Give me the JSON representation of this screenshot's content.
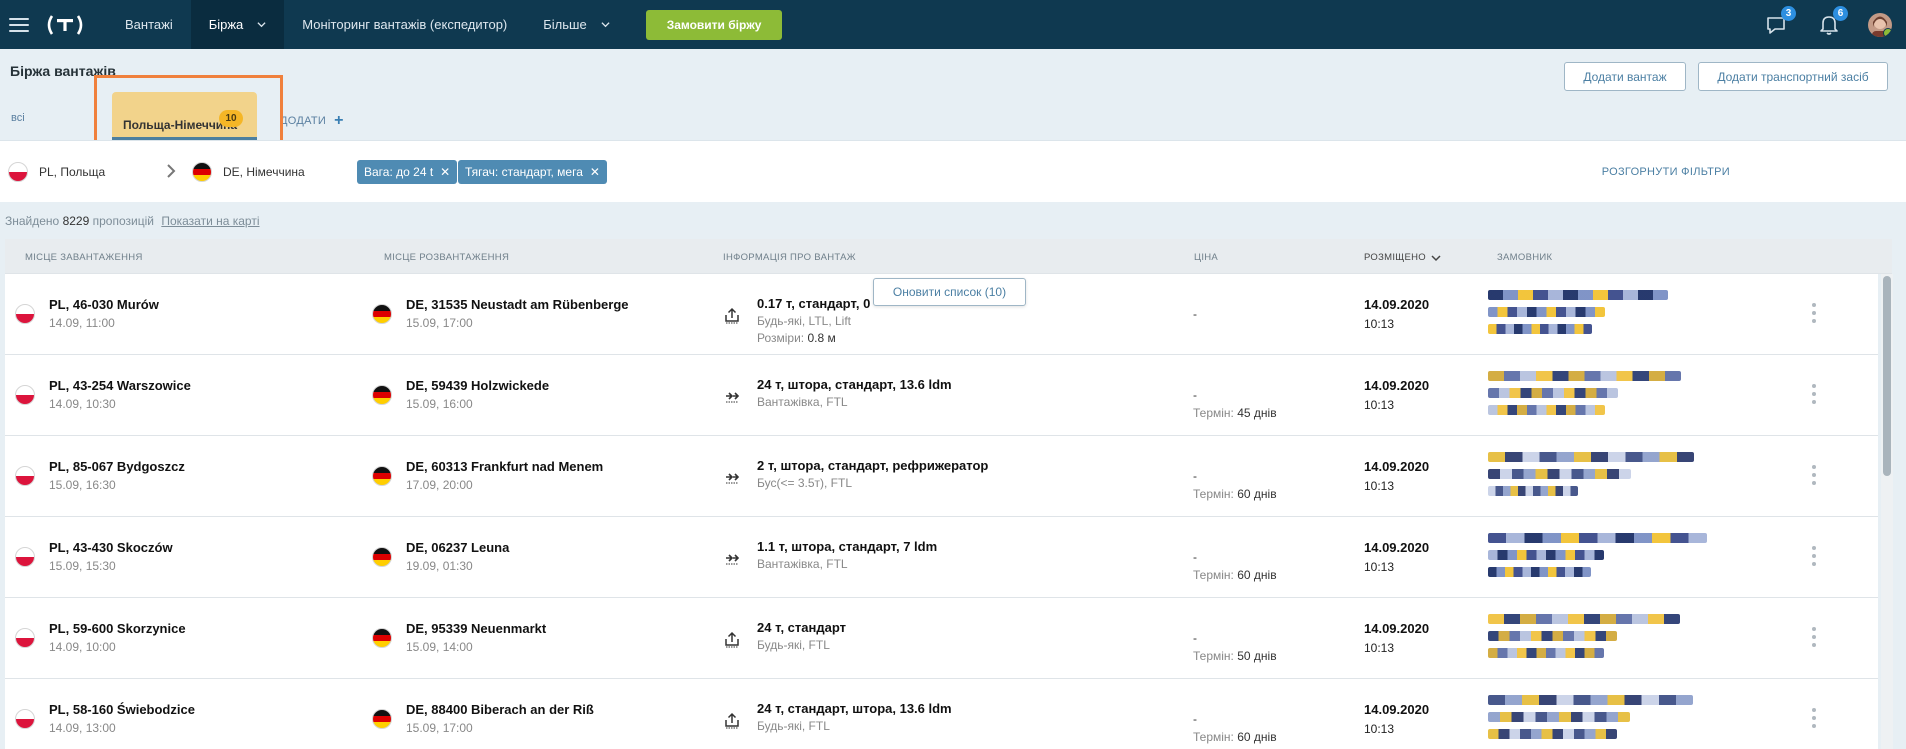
{
  "nav": {
    "logo_text": "(T)",
    "items": [
      {
        "label": "Вантажі",
        "active": false,
        "dropdown": false
      },
      {
        "label": "Біржа",
        "active": true,
        "dropdown": true
      },
      {
        "label": "Моніторинг вантажів (експедитор)",
        "active": false,
        "dropdown": false
      },
      {
        "label": "Більше",
        "active": false,
        "dropdown": true
      }
    ],
    "order_button": "Замовити біржу",
    "messages_badge": "3",
    "notifications_badge": "6"
  },
  "page": {
    "title": "Біржа вантажів",
    "add_cargo": "Додати вантаж",
    "add_vehicle": "Додати транспортний засіб"
  },
  "tabs": {
    "all": "всі",
    "active_label": "Польща-Німеччина",
    "active_count": "10",
    "add": "ДОДАТИ"
  },
  "filters": {
    "from": "PL, Польща",
    "to": "DE, Німеччина",
    "chips": [
      "Вага: до 24 t",
      "Тягач: стандарт, мега"
    ],
    "expand": "РОЗГОРНУТИ ФІЛЬТРИ"
  },
  "found": {
    "prefix": "Знайдено",
    "count": "8229",
    "suffix": "пропозицій",
    "map_link": "Показати на карті"
  },
  "table": {
    "headers": {
      "load": "МІСЦЕ ЗАВАНТАЖЕННЯ",
      "unload": "МІСЦЕ РОЗВАНТАЖЕННЯ",
      "info": "ІНФОРМАЦІЯ ПРО ВАНТАЖ",
      "price": "ЦІНА",
      "posted": "РОЗМІЩЕНО",
      "customer": "ЗАМОВНИК"
    },
    "refresh_button": "Оновити список (10)",
    "term_label": "Термін:",
    "size_label": "Розміри:",
    "rows": [
      {
        "load_title": "PL, 46-030 Murów",
        "load_date": "14.09, 11:00",
        "unload_title": "DE, 31535 Neustadt am Rübenberge",
        "unload_date": "15.09, 17:00",
        "info_title": "0.17 т, стандарт, 0",
        "info_sub": "Будь-які, LTL, Lift",
        "info_size": "0.8 м",
        "price": "-",
        "term": "",
        "posted_date": "14.09.2020",
        "posted_time": "10:13",
        "icon": "loading-up-icon"
      },
      {
        "load_title": "PL, 43-254 Warszowice",
        "load_date": "14.09, 10:30",
        "unload_title": "DE, 59439 Holzwickede",
        "unload_date": "15.09, 16:00",
        "info_title": "24 т, штора, стандарт, 13.6 ldm",
        "info_sub": "Вантажівка, FTL",
        "info_size": "",
        "price": "-",
        "term": "45 днів",
        "posted_date": "14.09.2020",
        "posted_time": "10:13",
        "icon": "truck-arrow-icon"
      },
      {
        "load_title": "PL, 85-067 Bydgoszcz",
        "load_date": "15.09, 16:30",
        "unload_title": "DE, 60313 Frankfurt nad Menem",
        "unload_date": "17.09, 20:00",
        "info_title": "2 т, штора, стандарт, рефрижератор",
        "info_sub": "Бус(<= 3.5т), FTL",
        "info_size": "",
        "price": "-",
        "term": "60 днів",
        "posted_date": "14.09.2020",
        "posted_time": "10:13",
        "icon": "truck-arrow-icon"
      },
      {
        "load_title": "PL, 43-430 Skoczów",
        "load_date": "15.09, 15:30",
        "unload_title": "DE, 06237 Leuna",
        "unload_date": "19.09, 01:30",
        "info_title": "1.1 т, штора, стандарт, 7 ldm",
        "info_sub": "Вантажівка, FTL",
        "info_size": "",
        "price": "-",
        "term": "60 днів",
        "posted_date": "14.09.2020",
        "posted_time": "10:13",
        "icon": "truck-arrow-icon"
      },
      {
        "load_title": "PL, 59-600 Skorzynice",
        "load_date": "14.09, 10:00",
        "unload_title": "DE, 95339 Neuenmarkt",
        "unload_date": "15.09, 14:00",
        "info_title": "24 т, стандарт",
        "info_sub": "Будь-які, FTL",
        "info_size": "",
        "price": "-",
        "term": "50 днів",
        "posted_date": "14.09.2020",
        "posted_time": "10:13",
        "icon": "loading-up-icon"
      },
      {
        "load_title": "PL, 58-160 Świebodzice",
        "load_date": "14.09, 13:00",
        "unload_title": "DE, 88400 Biberach an der Riß",
        "unload_date": "15.09, 17:00",
        "info_title": "24 т, стандарт, штора, 13.6 ldm",
        "info_sub": "Будь-які, FTL",
        "info_size": "",
        "price": "-",
        "term": "60 днів",
        "posted_date": "14.09.2020",
        "posted_time": "10:13",
        "icon": "loading-up-icon"
      }
    ]
  },
  "colors": {
    "nav_bg": "#0f3950",
    "accent_green": "#8dbb37",
    "chip_blue": "#4f8bb3",
    "tab_active": "#f2d38b",
    "highlight": "#f0803c"
  }
}
